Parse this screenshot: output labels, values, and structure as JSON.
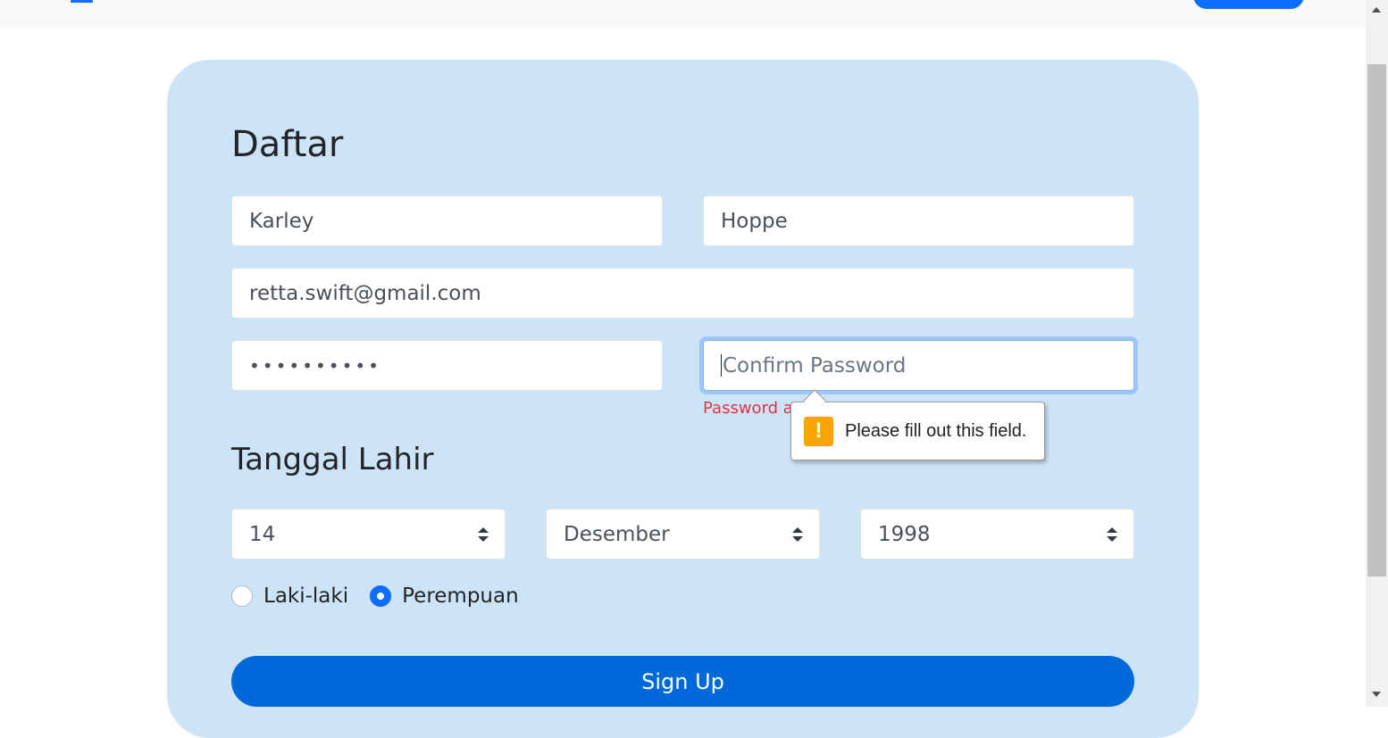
{
  "form": {
    "title": "Daftar",
    "first_name": {
      "value": "Karley"
    },
    "last_name": {
      "value": "Hoppe"
    },
    "email": {
      "value": "retta.swift@gmail.com"
    },
    "password": {
      "masked_value": "••••••••••"
    },
    "confirm_password": {
      "value": "",
      "placeholder": "Confirm Password",
      "state": "focused"
    },
    "error_text": "Password a",
    "validation_tooltip": {
      "message": "Please fill out this field.",
      "icon": "warning-icon"
    },
    "birthdate": {
      "title": "Tanggal Lahir",
      "day": "14",
      "month": "Desember",
      "year": "1998"
    },
    "gender": {
      "options": [
        "Laki-laki",
        "Perempuan"
      ],
      "selected": "Perempuan"
    },
    "submit_label": "Sign Up"
  },
  "colors": {
    "card_background": "#cde3f6",
    "primary": "#0069d9",
    "error": "#dc3545",
    "warning": "#f7a500"
  }
}
